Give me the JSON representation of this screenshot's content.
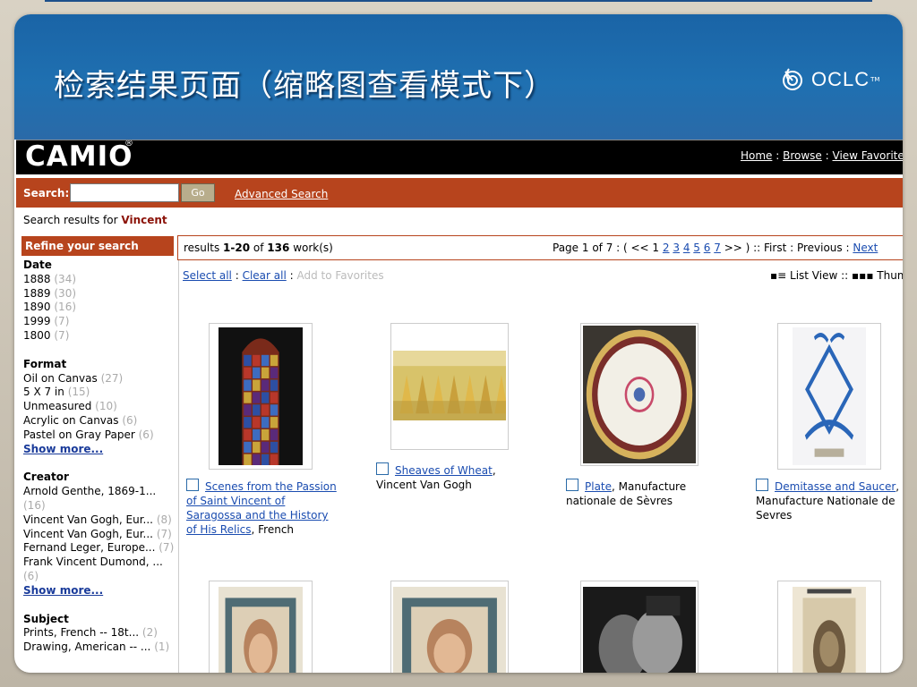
{
  "slide": {
    "title": "检索结果页面（缩略图查看模式下）",
    "logo_text": "OCLC",
    "logo_mark": "TM"
  },
  "camio": {
    "brand": "CAMIO",
    "reg_mark": "®",
    "nav": [
      {
        "label": "Home"
      },
      {
        "label": "Browse"
      },
      {
        "label": "View Favorites"
      }
    ],
    "nav_sep": ":"
  },
  "search": {
    "label": "Search:",
    "value": "",
    "go_label": "Go",
    "advanced_label": "Advanced Search"
  },
  "results_for": {
    "prefix": "Search results for",
    "term": "Vincent"
  },
  "refine": {
    "heading": "Refine your search",
    "facets": [
      {
        "title": "Date",
        "items": [
          {
            "label": "1888",
            "count": "(34)"
          },
          {
            "label": "1889",
            "count": "(30)"
          },
          {
            "label": "1890",
            "count": "(16)"
          },
          {
            "label": "1999",
            "count": "(7)"
          },
          {
            "label": "1800",
            "count": "(7)"
          }
        ],
        "show_more": ""
      },
      {
        "title": "Format",
        "items": [
          {
            "label": "Oil on Canvas",
            "count": "(27)"
          },
          {
            "label": "5 X 7 in",
            "count": "(15)"
          },
          {
            "label": "Unmeasured",
            "count": "(10)"
          },
          {
            "label": "Acrylic on Canvas",
            "count": "(6)"
          },
          {
            "label": "Pastel on Gray Paper",
            "count": "(6)"
          }
        ],
        "show_more": "Show more..."
      },
      {
        "title": "Creator",
        "items": [
          {
            "label": "Arnold Genthe, 1869-1...",
            "count": "(16)"
          },
          {
            "label": "Vincent Van Gogh, Eur...",
            "count": "(8)"
          },
          {
            "label": "Vincent Van Gogh, Eur...",
            "count": "(7)"
          },
          {
            "label": "Fernand Leger, Europe...",
            "count": "(7)"
          },
          {
            "label": "Frank Vincent Dumond, ...",
            "count": "(6)"
          }
        ],
        "show_more": "Show more..."
      },
      {
        "title": "Subject",
        "items": [
          {
            "label": "Prints, French -- 18t...",
            "count": "(2)"
          },
          {
            "label": "Drawing, American -- ...",
            "count": "(1)"
          }
        ],
        "show_more": ""
      }
    ]
  },
  "results": {
    "count_prefix": "results",
    "range": "1-20",
    "of": "of",
    "total": "136",
    "unit": "work(s)",
    "page_text": "Page 1 of 7 : ( << 1",
    "pages": [
      "2",
      "3",
      "4",
      "5",
      "6",
      "7"
    ],
    "pager_tail": ">> ) :: First : Previous :",
    "next_label": "Next"
  },
  "selection": {
    "select_all": "Select all",
    "clear_all": "Clear all",
    "add_favorites": "Add to Favorites",
    "sep": ":"
  },
  "view": {
    "list_icon": "▪≡",
    "list_label": "List View",
    "sep": "::",
    "thumb_icon": "▪▪▪",
    "thumb_label": "Thumb"
  },
  "items": [
    {
      "link": "Scenes from the Passion of Saint Vincent of Saragossa and the History of His Relics",
      "rest": ", French",
      "image": "stained-glass-window"
    },
    {
      "link": "Sheaves of Wheat",
      "rest": ", Vincent Van Gogh",
      "image": "wheat-painting"
    },
    {
      "link": "Plate",
      "rest": ", Manufacture nationale de Sèvres",
      "image": "porcelain-plate"
    },
    {
      "link": "Demitasse and Saucer",
      "rest": ", Manufacture Nationale de Sevres",
      "image": "monogram-mark"
    },
    {
      "link": "",
      "rest": "",
      "image": "pastel-portrait"
    },
    {
      "link": "",
      "rest": "",
      "image": "pastel-portrait"
    },
    {
      "link": "",
      "rest": "",
      "image": "photo-couple"
    },
    {
      "link": "",
      "rest": "",
      "image": "etching-portrait"
    }
  ],
  "colors": {
    "slide_header": "#1f70b1",
    "camio_bar": "#000000",
    "search_bar": "#b7441d",
    "link": "#1a4cb0"
  }
}
